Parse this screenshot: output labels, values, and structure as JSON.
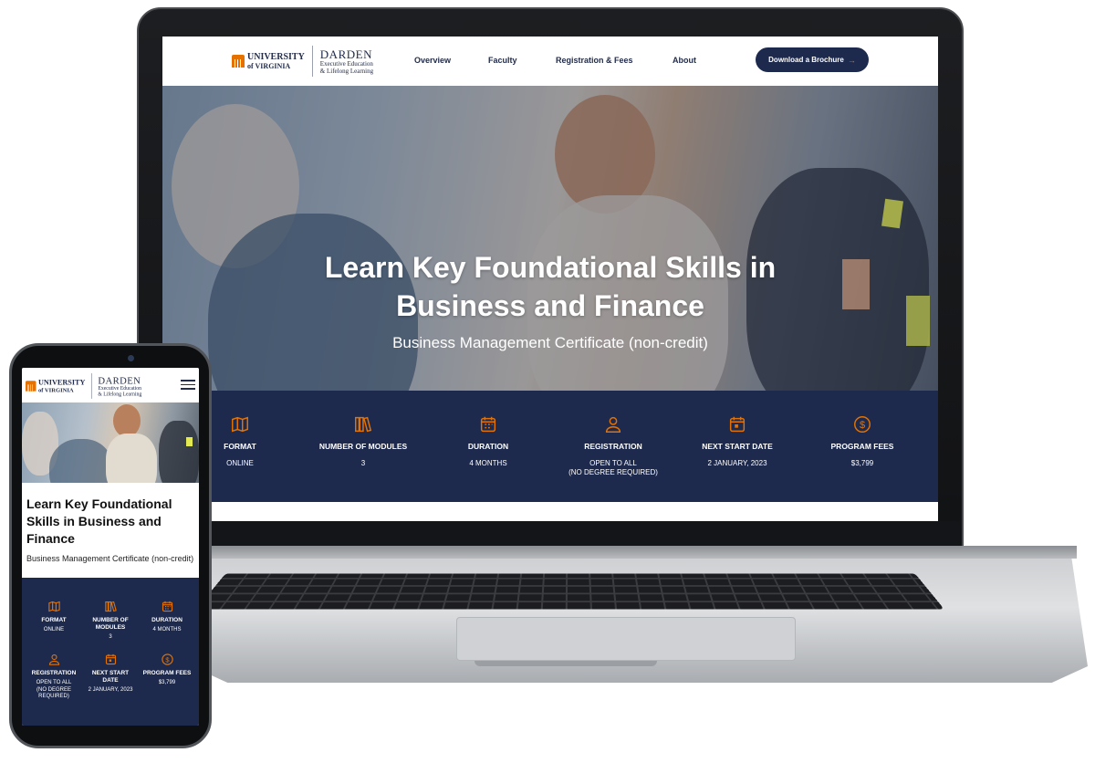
{
  "brand": {
    "university_line1": "UNIVERSITY",
    "university_line2": "VIRGINIA",
    "darden_name": "DARDEN",
    "darden_sub1": "Executive Education",
    "darden_sub2": "& Lifelong Learning"
  },
  "nav": {
    "items": [
      "Overview",
      "Faculty",
      "Registration & Fees",
      "About"
    ],
    "cta_label": "Download a Brochure",
    "cta_arrow": "→"
  },
  "hero": {
    "title_line1": "Learn Key Foundational Skills in",
    "title_line2": "Business and Finance",
    "subtitle": "Business Management Certificate (non-credit)"
  },
  "stats": [
    {
      "icon": "map-icon",
      "label": "FORMAT",
      "value": "ONLINE"
    },
    {
      "icon": "books-icon",
      "label": "NUMBER OF MODULES",
      "value": "3"
    },
    {
      "icon": "calendar-icon",
      "label": "DURATION",
      "value": "4 MONTHS"
    },
    {
      "icon": "person-icon",
      "label": "REGISTRATION",
      "value": "OPEN TO ALL",
      "value2": "(NO DEGREE REQUIRED)"
    },
    {
      "icon": "calendar-day-icon",
      "label": "NEXT START DATE",
      "value": "2 JANUARY, 2023"
    },
    {
      "icon": "dollar-icon",
      "label": "PROGRAM FEES",
      "value": "$3,799"
    }
  ],
  "mobile": {
    "title_line1": "Learn Key Foundational",
    "title_line2": "Skills in Business and",
    "title_line3": "Finance",
    "subtitle": "Business Management Certificate (non-credit)",
    "stats": [
      {
        "label1": "FORMAT",
        "label2": "",
        "value1": "ONLINE",
        "value2": "",
        "value3": ""
      },
      {
        "label1": "NUMBER OF",
        "label2": "MODULES",
        "value1": "3",
        "value2": "",
        "value3": ""
      },
      {
        "label1": "DURATION",
        "label2": "",
        "value1": "4 MONTHS",
        "value2": "",
        "value3": ""
      },
      {
        "label1": "REGISTRATION",
        "label2": "",
        "value1": "OPEN TO ALL",
        "value2": "(NO DEGREE",
        "value3": "REQUIRED)"
      },
      {
        "label1": "NEXT START",
        "label2": "DATE",
        "value1": "2 JANUARY, 2023",
        "value2": "",
        "value3": ""
      },
      {
        "label1": "PROGRAM FEES",
        "label2": "",
        "value1": "$3,799",
        "value2": "",
        "value3": ""
      }
    ]
  },
  "colors": {
    "navy": "#1d2a4e",
    "orange": "#e57200",
    "white": "#ffffff"
  }
}
